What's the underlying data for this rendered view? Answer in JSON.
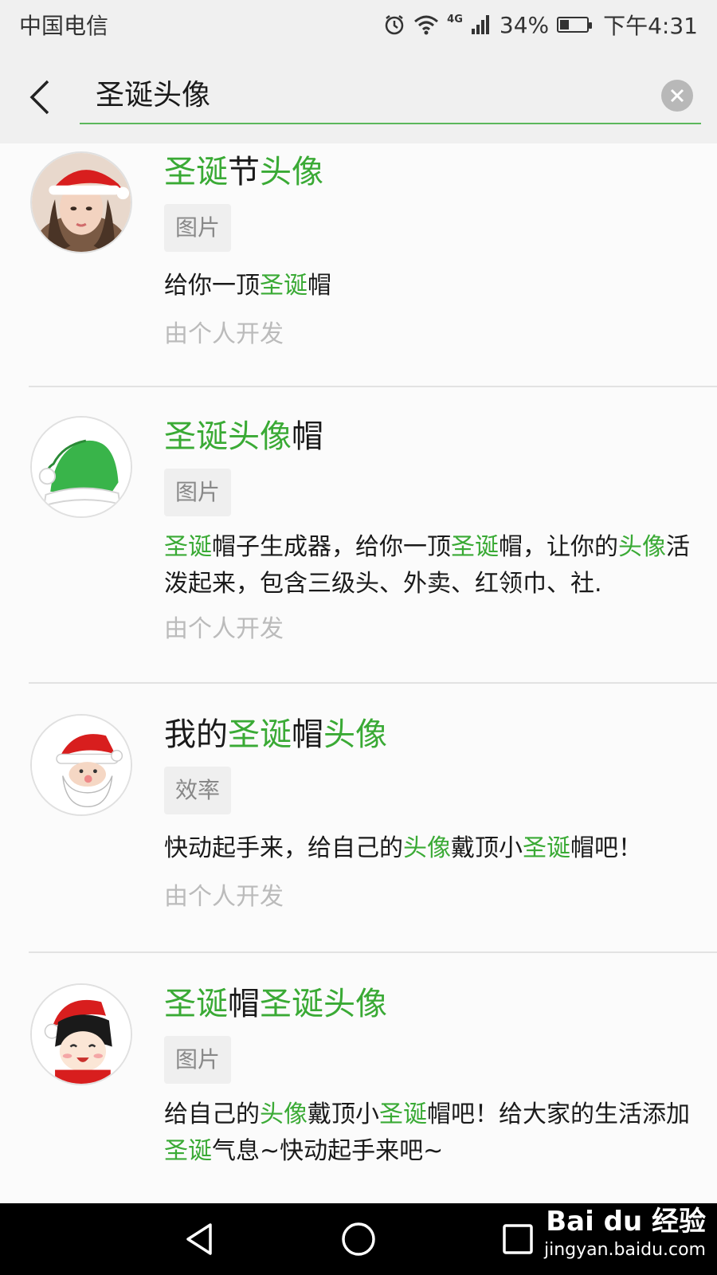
{
  "status_bar": {
    "carrier": "中国电信",
    "network": "4G",
    "battery": "34%",
    "battery_level": 0.34,
    "time": "下午4:31"
  },
  "search": {
    "query": "圣诞头像",
    "back_icon": "chevron-left-icon",
    "clear_icon": "close-circle-icon",
    "accent": "#5cb85c"
  },
  "highlight_color": "#3aaa35",
  "results": [
    {
      "title": [
        {
          "t": "圣诞",
          "h": true
        },
        {
          "t": "节",
          "h": false
        },
        {
          "t": "头像",
          "h": true
        }
      ],
      "category": "图片",
      "description": [
        {
          "t": "给你一顶",
          "h": false
        },
        {
          "t": "圣诞",
          "h": true
        },
        {
          "t": "帽",
          "h": false
        }
      ],
      "developer": "由个人开发",
      "avatar_icon": "girl-santa-hat-avatar"
    },
    {
      "title": [
        {
          "t": "圣诞头像",
          "h": true
        },
        {
          "t": "帽",
          "h": false
        }
      ],
      "category": "图片",
      "description": [
        {
          "t": "圣诞",
          "h": true
        },
        {
          "t": "帽子生成器，给你一顶",
          "h": false
        },
        {
          "t": "圣诞",
          "h": true
        },
        {
          "t": "帽，让你的",
          "h": false
        },
        {
          "t": "头像",
          "h": true
        },
        {
          "t": "活泼起来，包含三级头、外卖、红领巾、社.",
          "h": false
        }
      ],
      "developer": "由个人开发",
      "avatar_icon": "green-santa-hat-icon"
    },
    {
      "title": [
        {
          "t": "我的",
          "h": false
        },
        {
          "t": "圣诞",
          "h": true
        },
        {
          "t": "帽",
          "h": false
        },
        {
          "t": "头像",
          "h": true
        }
      ],
      "category": "效率",
      "description": [
        {
          "t": "快动起手来，给自己的",
          "h": false
        },
        {
          "t": "头像",
          "h": true
        },
        {
          "t": "戴顶小",
          "h": false
        },
        {
          "t": "圣诞",
          "h": true
        },
        {
          "t": "帽吧！",
          "h": false
        }
      ],
      "developer": "由个人开发",
      "avatar_icon": "santa-claus-icon"
    },
    {
      "title": [
        {
          "t": "圣诞",
          "h": true
        },
        {
          "t": "帽",
          "h": false
        },
        {
          "t": "圣诞头像",
          "h": true
        }
      ],
      "category": "图片",
      "description": [
        {
          "t": "给自己的",
          "h": false
        },
        {
          "t": "头像",
          "h": true
        },
        {
          "t": "戴顶小",
          "h": false
        },
        {
          "t": "圣诞",
          "h": true
        },
        {
          "t": "帽吧！给大家的生活添加",
          "h": false
        },
        {
          "t": "圣诞",
          "h": true
        },
        {
          "t": "气息~快动起手来吧~",
          "h": false
        }
      ],
      "developer": "",
      "avatar_icon": "cartoon-girl-santa-hat-icon"
    }
  ],
  "nav_bar": {
    "back_icon": "triangle-back-icon",
    "home_icon": "circle-home-icon",
    "recents_icon": "square-recents-icon"
  },
  "watermark": {
    "brand": "Bai du 经验",
    "site": "jingyan.baidu.com"
  }
}
